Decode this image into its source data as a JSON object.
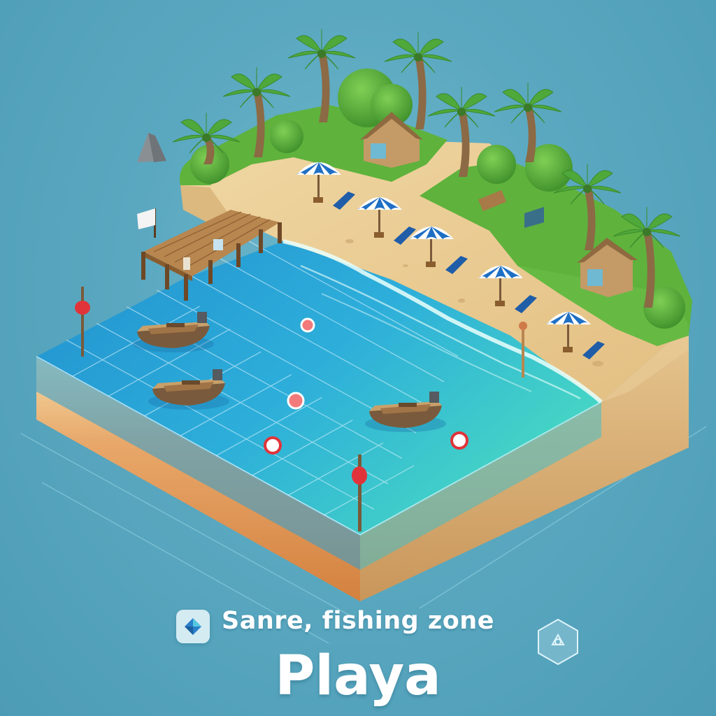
{
  "caption": {
    "subtitle": "Sanre, fishing zone",
    "title": "Playa"
  },
  "icons": {
    "badge_left": "diamond-logo-icon",
    "badge_right": "hexagon-emblem-icon"
  },
  "colors": {
    "sea": "#5aa8c0",
    "water_deep": "#1e88c8",
    "water_shallow": "#3fd6c6",
    "sand": "#e8c98e",
    "grass": "#5fb23c",
    "umbrella": "#1f6fc4",
    "buoy": "#e0343a",
    "text": "#ffffff"
  }
}
